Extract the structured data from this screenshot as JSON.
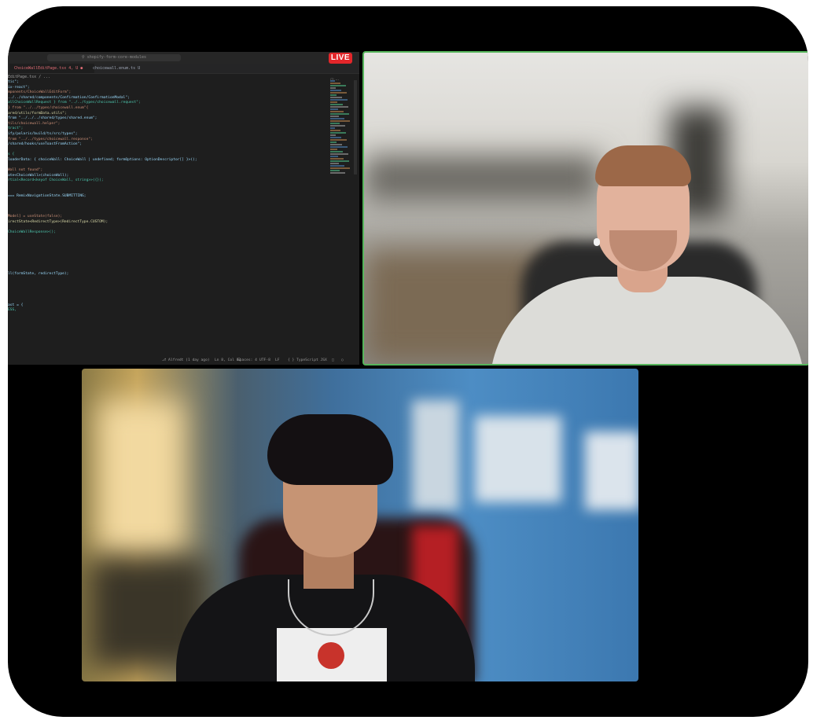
{
  "live_badge": "LIVE",
  "editor": {
    "search_placeholder": "shopify-form-core-modules",
    "tabs": [
      {
        "label": "ChoiceWallEditPage.tsx 4, U  ●",
        "active": true
      },
      {
        "label": "choicewall.enum.ts U",
        "active": false
      }
    ],
    "breadcrumb": "EditPage.tsx / ...",
    "code_lines": [
      "tic\";",
      "ix-react\";",
      "mponents/ChoiceWallEditForm\";",
      "../../shared/components/Confirmation/ConfirmationModal\";",
      "allChoiceWallRequest } from \"../../types/choicewall.request\";",
      "} from \"../../types/choicewall.enum\"{",
      "ared/utils/formData.utils\";",
      "from \"../../../shared/types/shared.enum\";",
      "tils/choicewall.helper\";",
      "tract\";",
      "ify/polaris/build/ts/src/types\";",
      "from \"../../types/choicewall.response\";",
      "/shared/hooks/useToastFromAction\";",
      "",
      "s {",
      "loaderData: { choiceWall: ChoiceWall | undefined; formOptions: OptionDescriptor[] }>();",
      "",
      "Wall not found\";",
      "ate<ChoiceWall>(choiceWall);",
      "rtial<Record<keyof ChoiceWall, string>>({});",
      "",
      "",
      "=== RemixNavigationState.SUBMITTING;",
      "",
      "",
      "",
      "Model] = useState(false);",
      "irectState<RedirectType>(RedirectType.CUSTOM);",
      "",
      "ChoiceWallResponse>();",
      "",
      "",
      "",
      "",
      "",
      "",
      "",
      "ll(formState, redirectType);",
      "",
      "",
      "",
      "",
      "",
      "ast = {",
      "ESS,"
    ],
    "status_items": [
      "⎇ Alfredt (1 day ago)",
      "Ln 8, Col 82",
      "Spaces: 4",
      "UTF-8",
      "LF",
      "{ } TypeScript JSX"
    ]
  },
  "colors": {
    "frame_background": "#000000",
    "editor_background": "#1e1e1e",
    "live_badge": "#e3262a",
    "active_speaker_border": "#56b55b"
  },
  "participants": [
    {
      "role": "participant-top-right",
      "active_speaker": true
    },
    {
      "role": "participant-bottom",
      "active_speaker": false
    }
  ]
}
